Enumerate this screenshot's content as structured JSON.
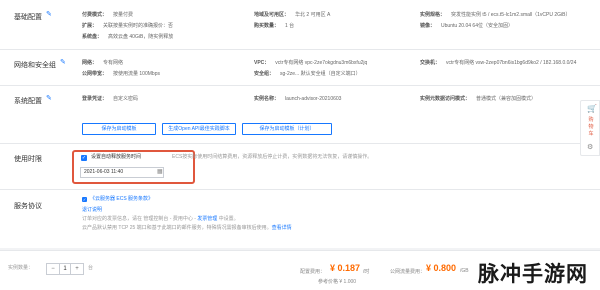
{
  "basic_config": {
    "title": "基础配置",
    "rows": [
      {
        "k": "付费模式：",
        "v": "按量付费"
      },
      {
        "k": "扩展：",
        "v": "关联按量实例时的准确报价：否"
      },
      {
        "k": "系统盘：",
        "v": "高效云盘 40GiB，随实例释放"
      }
    ],
    "mid": [
      {
        "k": "地域及可用区：",
        "v": "华北 2 可用区 A"
      },
      {
        "k": "购买数量：",
        "v": "1 台"
      }
    ],
    "right": [
      {
        "k": "实例规格：",
        "v": "突发性能实例 t5 / ecs.t5-lc1m2.small（1vCPU 2GiB）"
      },
      {
        "k": "镜像：",
        "v": "Ubuntu 20.04 64位（安全加固）"
      }
    ]
  },
  "network_config": {
    "title": "网络和安全组",
    "left": [
      {
        "k": "网络：",
        "v": "专有网络"
      },
      {
        "k": "公网带宽：",
        "v": "按使用流量 100Mbps"
      }
    ],
    "mid": [
      {
        "k": "VPC：",
        "v": "vctr专有网络 vpc-2ze7okgdnu3m6bxfu2jq"
      },
      {
        "k": "安全组：",
        "v": "sg-2ze... 默认安全组（自定义端口）"
      }
    ],
    "right": [
      {
        "k": "交换机：",
        "v": "vctr专有网络 vsw-2zep07bn6is1bg6d9ko2 / 182.168.0.0/24"
      }
    ]
  },
  "system_config": {
    "title": "系统配置",
    "left": [
      {
        "k": "登录凭证：",
        "v": "自定义密码"
      }
    ],
    "mid": [
      {
        "k": "实例名称：",
        "v": "launch-advisor-20210603"
      }
    ],
    "right": [
      {
        "k": "实例元数据访问模式：",
        "v": "普通模式（兼容加固模式）"
      }
    ],
    "buttons": [
      "保存为启动模板",
      "生成Open API最佳实践脚本",
      "保存为启动模板（计划）"
    ]
  },
  "usage_time": {
    "title": "使用时限",
    "checkbox_label": "设置自动释放服务时间",
    "hint": "ECS按实际使用时间结算费用，资源释放后停止计费，实例数据将无法恢复，请谨慎操作。",
    "datetime_value": "2021-06-03 11:40",
    "checked": true
  },
  "service_agreement": {
    "title": "服务协议",
    "agreement_link": "《云服务器 ECS 服务条款》",
    "refund_link": "退订说明",
    "line1": "订单对应的发票信息，请在 管理控制台 - 费用中心 - ",
    "line1_link": "发票管理",
    "line1_tail": " 中设置。",
    "line2": "云产品默认禁用 TCP 25 端口和基于此端口的邮件服务，特殊情况需报备审核后使用。",
    "line2_link": "查看详情"
  },
  "side_widget": {
    "label_chars": [
      "购",
      "物",
      "车"
    ]
  },
  "footer": {
    "qty_label": "实例数量：",
    "qty_minus": "−",
    "qty_value": "1",
    "qty_plus": "+",
    "qty_unit": "台",
    "config_fee_label": "配置费用：",
    "config_fee": "¥ 0.187",
    "config_fee_unit": "/时",
    "config_fee_sub": "参考价格 ¥ 1.000",
    "bandwidth_fee_label": "公网流量费用：",
    "bandwidth_fee": "¥ 0.800",
    "bandwidth_fee_unit": "/GB"
  },
  "watermark": "脉冲手游网",
  "colors": {
    "accent": "#1677ff",
    "highlight_box": "#e0573d",
    "price": "#ff6a00"
  }
}
